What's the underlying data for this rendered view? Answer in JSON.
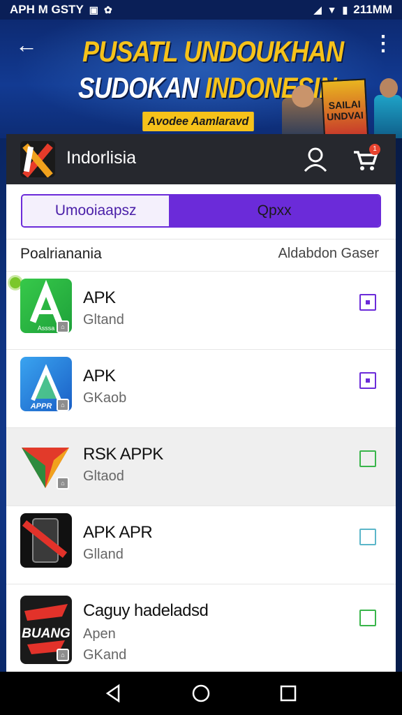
{
  "status_bar": {
    "left_text": "APH M GSTY",
    "time": "211MM"
  },
  "banner": {
    "title_line1": "PUSATL UNDOUKHAN",
    "title_line2_a": "SUDOKAN ",
    "title_line2_b": "INDONESIN",
    "tag": "Avodee Aamlaravd",
    "poster_text": "SAILAI UNDVAI"
  },
  "header": {
    "app_name": "Indorlisia",
    "cart_count": "1"
  },
  "tabs": {
    "tab1": "Umooiaapsz",
    "tab2": "Qpxx"
  },
  "list": {
    "left_heading": "Poalrianania",
    "right_heading": "Aldabdon Gaser",
    "items": [
      {
        "title": "APK",
        "sub": "Gltand"
      },
      {
        "title": "APK",
        "sub": "GKaob"
      },
      {
        "title": "RSK APPK",
        "sub": "Gltaod"
      },
      {
        "title": "APK APR",
        "sub": "Glland"
      },
      {
        "title": "Caguy hadeladsd",
        "sub": "Apen",
        "sub2": "GKand"
      }
    ],
    "icon_labels": [
      "Asssa",
      "APPR",
      "BUANG"
    ]
  },
  "colors": {
    "accent": "#6b2bd9",
    "banner_yellow": "#f6c21a",
    "header_dark": "#26282e"
  }
}
